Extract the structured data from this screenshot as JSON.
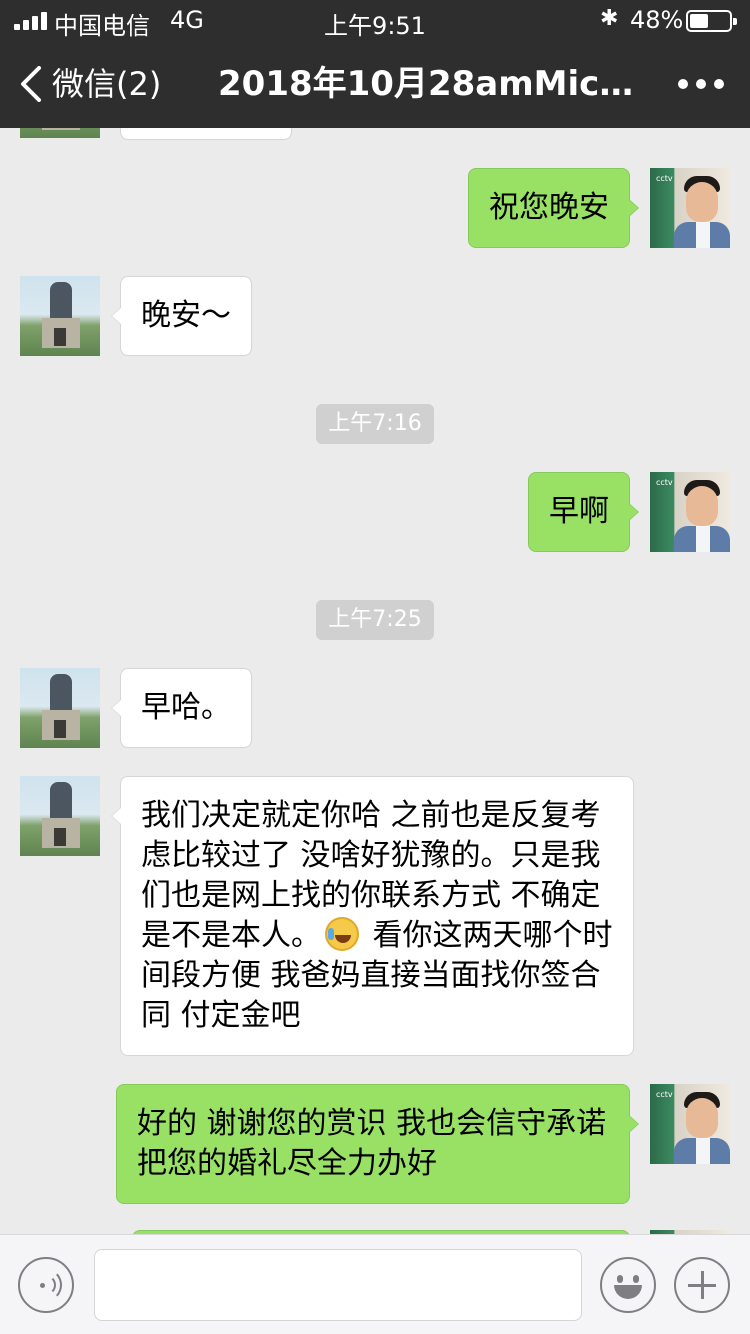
{
  "status_bar": {
    "carrier": "中国电信",
    "network": "4G",
    "time": "上午9:51",
    "battery": "48%",
    "battery_level": 0.48,
    "icons": [
      "signal-icon",
      "bluetooth-icon",
      "battery-icon"
    ]
  },
  "nav": {
    "back_label": "微信(2)",
    "title": "2018年10月28amMich...",
    "icons": [
      "back-chevron-icon",
      "more-icon"
    ]
  },
  "messages": [
    {
      "from": "me",
      "text": "祝您晚安"
    },
    {
      "from": "contact",
      "text": "晚安～"
    },
    {
      "timestamp": "上午7:16"
    },
    {
      "from": "me",
      "text": "早啊"
    },
    {
      "timestamp": "上午7:25"
    },
    {
      "from": "contact",
      "text": "早哈。"
    },
    {
      "from": "contact",
      "text_before_emoji": "我们决定就定你哈 之前也是反复考虑比较过了 没啥好犹豫的。只是我们也是网上找的你联系方式 不确定是不是本人。",
      "emoji": "sob-laugh-emoji-icon",
      "text_after_emoji": " 看你这两天哪个时间段方便 我爸妈直接当面找你签合同 付定金吧"
    },
    {
      "from": "me",
      "text": "好的 谢谢您的赏识 我也会信守承诺 把您的婚礼尽全力办好"
    }
  ],
  "input_bar": {
    "text_value": "",
    "icons": [
      "voice-icon",
      "emoji-icon",
      "plus-icon"
    ]
  },
  "colors": {
    "nav_bg": "#2e2e2e",
    "chat_bg": "#ebebeb",
    "outgoing_bubble": "#98e165",
    "incoming_bubble": "#ffffff",
    "timestamp_bg": "#d0d0d0"
  }
}
